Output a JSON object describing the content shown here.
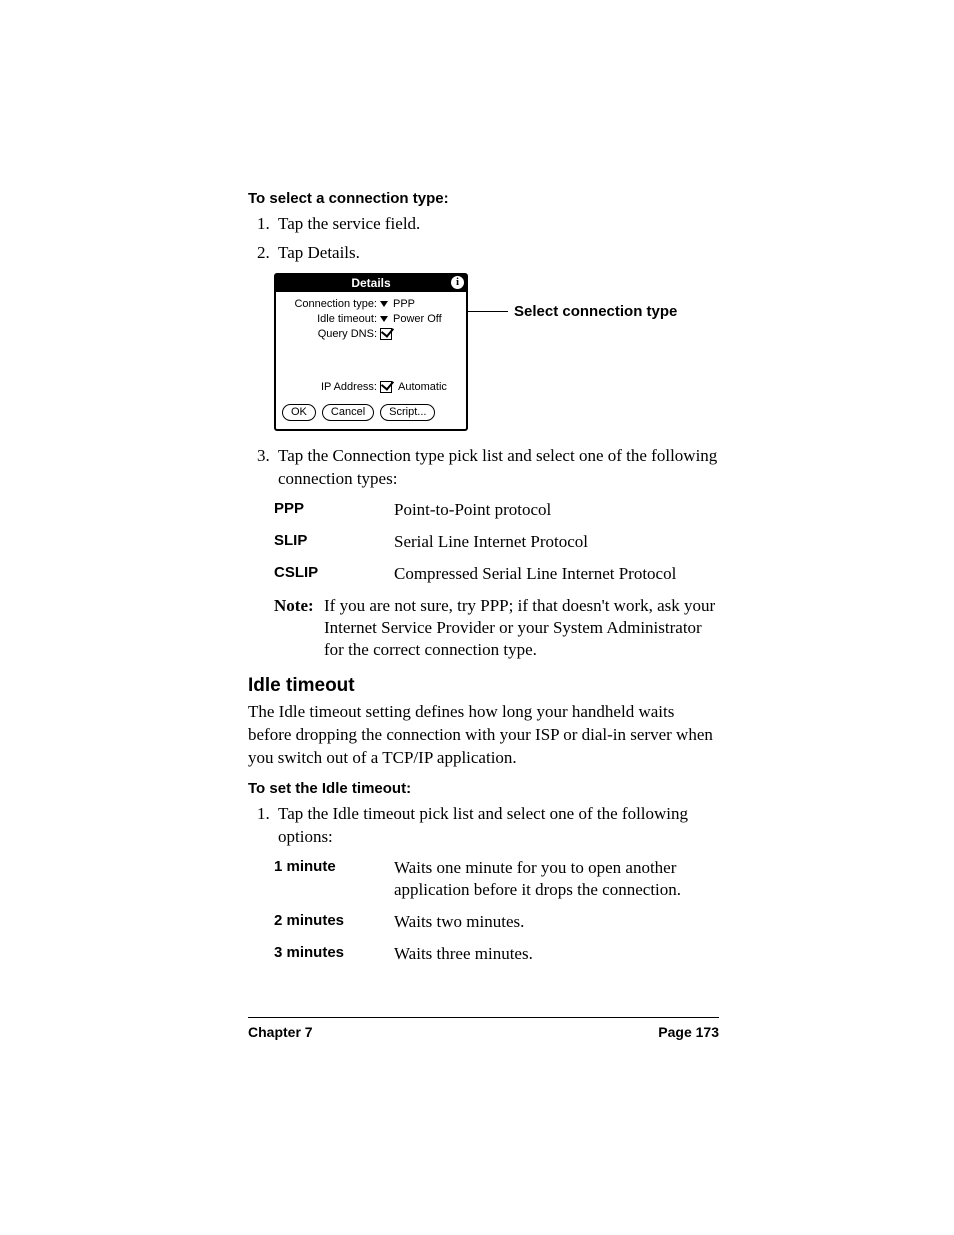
{
  "proc1": {
    "heading": "To select a connection type:",
    "steps": [
      "Tap the service field.",
      "Tap Details."
    ]
  },
  "dialog": {
    "title": "Details",
    "info_glyph": "i",
    "rows": {
      "conn_type_label": "Connection type:",
      "conn_type_value": "PPP",
      "idle_label": "Idle timeout:",
      "idle_value": "Power Off",
      "dns_label": "Query DNS:",
      "ip_label": "IP Address:",
      "ip_value": "Automatic"
    },
    "buttons": {
      "ok": "OK",
      "cancel": "Cancel",
      "script": "Script..."
    },
    "callout": "Select connection type"
  },
  "proc1b": {
    "steps": [
      "Tap the Connection type pick list and select one of the following connection types:"
    ]
  },
  "conn_types": [
    {
      "term": "PPP",
      "desc": "Point-to-Point protocol"
    },
    {
      "term": "SLIP",
      "desc": "Serial Line Internet Protocol"
    },
    {
      "term": "CSLIP",
      "desc": "Compressed Serial Line Internet Protocol"
    }
  ],
  "note": {
    "label": "Note:",
    "text": "If you are not sure, try PPP; if that doesn't work, ask your Internet Service Provider or your System Administrator for the correct connection type."
  },
  "section": {
    "heading": "Idle timeout",
    "body": "The Idle timeout setting defines how long your handheld waits before dropping the connection with your ISP or dial-in server when you switch out of a TCP/IP application."
  },
  "proc2": {
    "heading": "To set the Idle timeout:",
    "steps": [
      "Tap the Idle timeout pick list and select one of the following options:"
    ]
  },
  "timeout_options": [
    {
      "term": "1 minute",
      "desc": "Waits one minute for you to open another application before it drops the connection."
    },
    {
      "term": "2 minutes",
      "desc": "Waits two minutes."
    },
    {
      "term": "3 minutes",
      "desc": "Waits three minutes."
    }
  ],
  "footer": {
    "left": "Chapter 7",
    "right": "Page 173"
  }
}
